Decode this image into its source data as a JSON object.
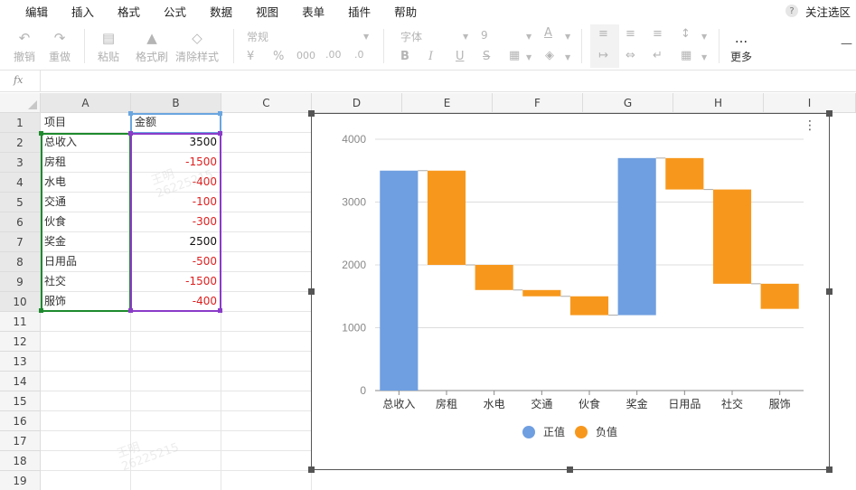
{
  "menu": [
    "编辑",
    "插入",
    "格式",
    "公式",
    "数据",
    "视图",
    "表单",
    "插件",
    "帮助"
  ],
  "menu_right": {
    "help": "?",
    "focus": "关注选区"
  },
  "toolbar": {
    "undo": "撤销",
    "redo": "重做",
    "paste": "粘贴",
    "format_painter": "格式刷",
    "clear_format": "清除样式",
    "number_format": "常规",
    "currency": "¥",
    "percent": "%",
    "thousands": "000",
    "dec_increase": ".00",
    "dec_decrease": ".0",
    "font": "字体",
    "font_size": "9",
    "text_color": "A",
    "bold": "B",
    "italic": "I",
    "underline": "U",
    "strike": "S",
    "more_icon": "...",
    "more": "更多"
  },
  "formula_bar": {
    "fx": "fx",
    "value": ""
  },
  "columns": [
    "A",
    "B",
    "C",
    "D",
    "E",
    "F",
    "G",
    "H",
    "I"
  ],
  "rows": [
    "1",
    "2",
    "3",
    "4",
    "5",
    "6",
    "7",
    "8",
    "9",
    "10",
    "11",
    "12",
    "13",
    "14",
    "15",
    "16",
    "17",
    "18",
    "19"
  ],
  "table": [
    {
      "item": "项目",
      "amount": "金额"
    },
    {
      "item": "总收入",
      "amount": "3500"
    },
    {
      "item": "房租",
      "amount": "-1500"
    },
    {
      "item": "水电",
      "amount": "-400"
    },
    {
      "item": "交通",
      "amount": "-100"
    },
    {
      "item": "伙食",
      "amount": "-300"
    },
    {
      "item": "奖金",
      "amount": "2500"
    },
    {
      "item": "日用品",
      "amount": "-500"
    },
    {
      "item": "社交",
      "amount": "-1500"
    },
    {
      "item": "服饰",
      "amount": "-400"
    }
  ],
  "colors": {
    "positive": "#6f9fe0",
    "negative": "#f7981d",
    "selection_a": "#1e8a2e",
    "selection_b": "#8a3cc8"
  },
  "watermark": {
    "name": "王明",
    "id": "26225215"
  },
  "chart_data": {
    "type": "bar",
    "subtype": "waterfall",
    "title": "",
    "categories": [
      "总收入",
      "房租",
      "水电",
      "交通",
      "伙食",
      "奖金",
      "日用品",
      "社交",
      "服饰"
    ],
    "deltas": [
      3500,
      -1500,
      -400,
      -100,
      -300,
      2500,
      -500,
      -1500,
      -400
    ],
    "ranges": [
      [
        0,
        3500
      ],
      [
        2000,
        3500
      ],
      [
        1600,
        2000
      ],
      [
        1500,
        1600
      ],
      [
        1200,
        1500
      ],
      [
        1200,
        3700
      ],
      [
        3200,
        3700
      ],
      [
        1700,
        3200
      ],
      [
        1300,
        1700
      ]
    ],
    "series": [
      {
        "name": "正值"
      },
      {
        "name": "负值"
      }
    ],
    "ylim": [
      0,
      4000
    ],
    "yticks": [
      "0",
      "1000",
      "2000",
      "3000",
      "4000"
    ],
    "grid": true,
    "legend": "bottom"
  }
}
